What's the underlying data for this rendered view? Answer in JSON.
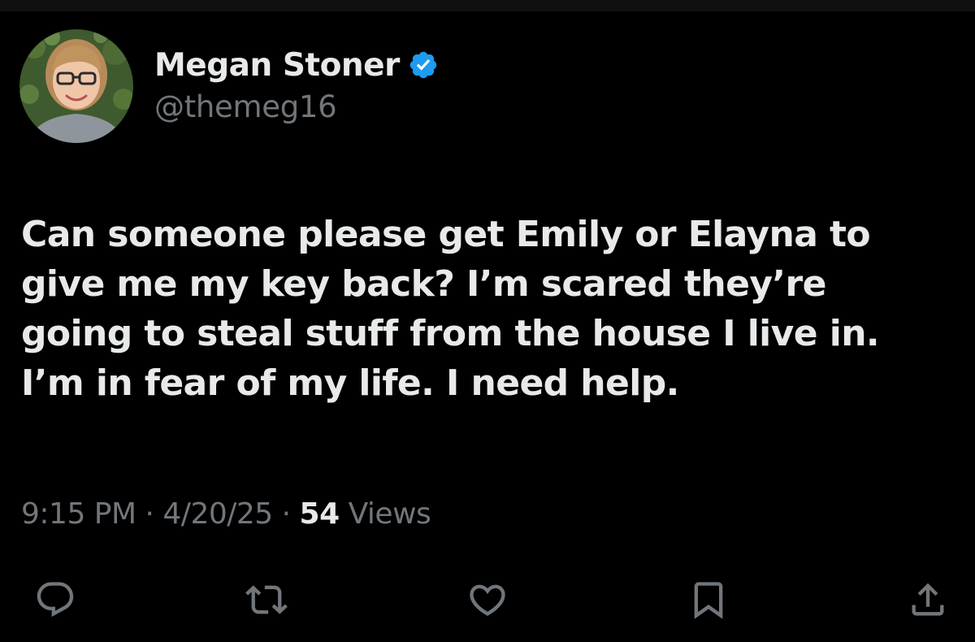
{
  "tweet": {
    "author": {
      "display_name": "Megan Stoner",
      "handle": "@themeg16",
      "verified": true,
      "avatar_icon": "profile-photo"
    },
    "text": "Can someone please get Emily or Elayna to\ngive me my key back? I’m scared they’re\ngoing to steal stuff from the house I live in.\nI’m in fear of my life. I need help.",
    "meta": {
      "time": "9:15 PM",
      "separator": " · ",
      "date": "4/20/25",
      "views_count": "54",
      "views_label": " Views"
    },
    "actions": [
      {
        "icon": "reply-icon"
      },
      {
        "icon": "retweet-icon"
      },
      {
        "icon": "like-icon"
      },
      {
        "icon": "bookmark-icon"
      },
      {
        "icon": "share-icon"
      }
    ]
  },
  "colors": {
    "background": "#000000",
    "primary_text": "#e7e9ea",
    "secondary_text": "#71767b",
    "verified_badge": "#1d9bf0"
  }
}
